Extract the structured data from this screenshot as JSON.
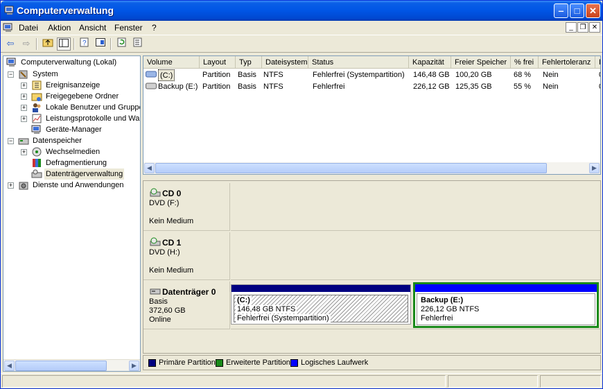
{
  "window": {
    "title": "Computerverwaltung"
  },
  "menu": {
    "items": [
      "Datei",
      "Aktion",
      "Ansicht",
      "Fenster",
      "?"
    ]
  },
  "tree": {
    "root": "Computerverwaltung (Lokal)",
    "system": "System",
    "ereignis": "Ereignisanzeige",
    "ordner": "Freigegebene Ordner",
    "benutzer": "Lokale Benutzer und Gruppe",
    "leistung": "Leistungsprotokolle und War",
    "geraete": "Geräte-Manager",
    "speicher": "Datenspeicher",
    "wechsel": "Wechselmedien",
    "defrag": "Defragmentierung",
    "dtv": "Datenträgerverwaltung",
    "dienste": "Dienste und Anwendungen"
  },
  "volumes": {
    "columns": [
      "Volume",
      "Layout",
      "Typ",
      "Dateisystem",
      "Status",
      "Kapazität",
      "Freier Speicher",
      "% frei",
      "Fehlertoleranz",
      "F"
    ],
    "rows": [
      [
        "(C:)",
        "Partition",
        "Basis",
        "NTFS",
        "Fehlerfrei (Systempartition)",
        "146,48 GB",
        "100,20 GB",
        "68 %",
        "Nein",
        "0"
      ],
      [
        "Backup (E:)",
        "Partition",
        "Basis",
        "NTFS",
        "Fehlerfrei",
        "226,12 GB",
        "125,35 GB",
        "55 %",
        "Nein",
        "0"
      ]
    ]
  },
  "disks": {
    "cd0": {
      "name": "CD 0",
      "type": "DVD (F:)",
      "media": "Kein Medium"
    },
    "cd1": {
      "name": "CD 1",
      "type": "DVD (H:)",
      "media": "Kein Medium"
    },
    "disk0": {
      "name": "Datenträger 0",
      "kind": "Basis",
      "size": "372,60 GB",
      "state": "Online",
      "c": {
        "name": "(C:)",
        "size": "146,48 GB NTFS",
        "status": "Fehlerfrei (Systempartition)"
      },
      "e": {
        "name": "Backup  (E:)",
        "size": "226,12 GB NTFS",
        "status": "Fehlerfrei"
      }
    }
  },
  "legend": {
    "primary": "Primäre Partition",
    "extended": "Erweiterte Partition",
    "logical": "Logisches Laufwerk"
  },
  "colors": {
    "primary": "#000080",
    "extended": "#1a8a1a",
    "logical": "#0000ff",
    "titlebar": "#0055e5"
  }
}
